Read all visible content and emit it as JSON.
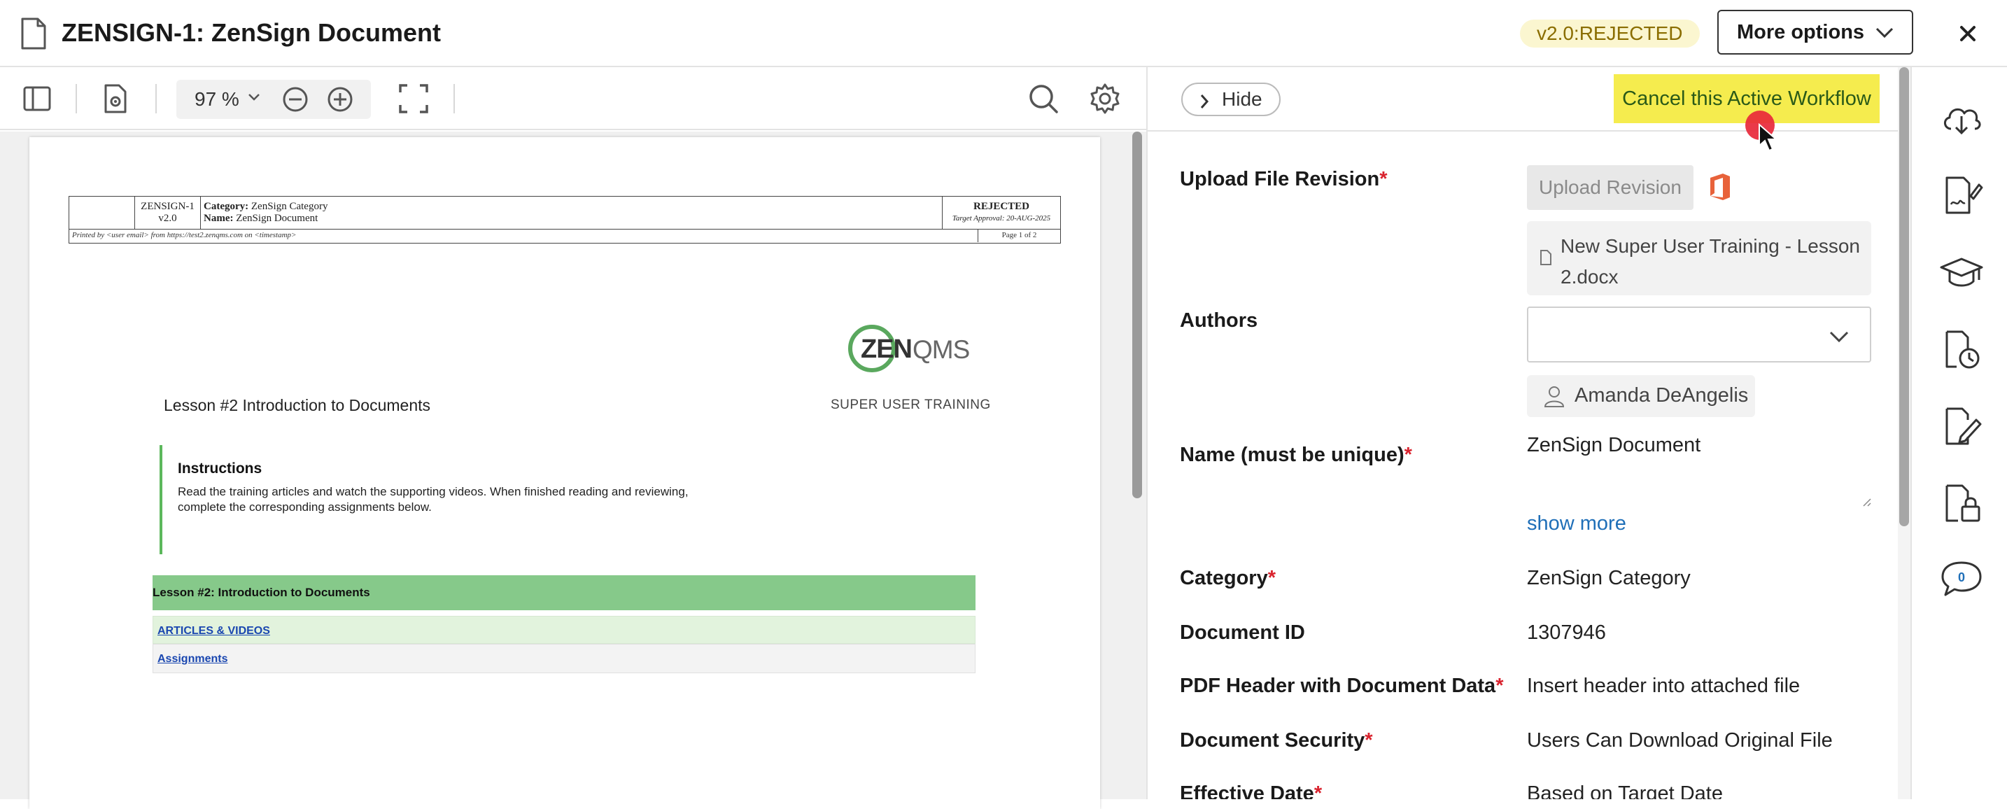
{
  "header": {
    "title": "ZENSIGN-1: ZenSign Document",
    "version_badge": "v2.0:REJECTED",
    "more_options_label": "More options"
  },
  "viewer": {
    "zoom_value": "97 %"
  },
  "document": {
    "header_table": {
      "doc_id": "ZENSIGN-1",
      "version": "v2.0",
      "category_label": "Category:",
      "category_value": "ZenSign Category",
      "name_label": "Name:",
      "name_value": "ZenSign Document",
      "status": "REJECTED",
      "target_approval": "Target Approval: 20-AUG-2025",
      "printed_by": "Printed by <user email> from https://test2.zenqms.com on <timestamp>",
      "page": "Page 1 of 2"
    },
    "logo_text_zen": "ZEN",
    "logo_text_qms": "QMS",
    "logo_subtitle": "SUPER USER TRAINING",
    "lesson_title": "Lesson #2 Introduction to Documents",
    "instructions_heading": "Instructions",
    "instructions_body": "Read the training articles and watch the supporting videos. When finished reading and reviewing, complete the corresponding assignments below.",
    "green_bar_title": "Lesson #2: Introduction to Documents",
    "link_articles": "ARTICLES & VIDEOS",
    "link_assignments": "Assignments"
  },
  "panel": {
    "hide_label": "Hide",
    "cancel_workflow_label": "Cancel this Active Workflow",
    "upload_file_label": "Upload File Revision",
    "upload_revision_button": "Upload Revision",
    "file_name": "New Super User Training - Lesson 2.docx",
    "authors_label": "Authors",
    "author_name": "Amanda DeAngelis",
    "name_label": "Name (must be unique)",
    "name_value": "ZenSign Document",
    "show_more": "show more",
    "category_label": "Category",
    "category_value": "ZenSign Category",
    "document_id_label": "Document ID",
    "document_id_value": "1307946",
    "pdf_header_label": "PDF Header with Document Data",
    "pdf_header_value": "Insert header into attached file",
    "doc_security_label": "Document Security",
    "doc_security_value": "Users Can Download Original File",
    "effective_date_label": "Effective Date",
    "effective_date_value": "Based on Target Date"
  },
  "rail": {
    "comment_count": "0"
  },
  "colors": {
    "accent_yellow": "#f5ec4e",
    "required_red": "#d9232e",
    "link_blue": "#1f6fb8",
    "green_bar": "#86c98a"
  }
}
